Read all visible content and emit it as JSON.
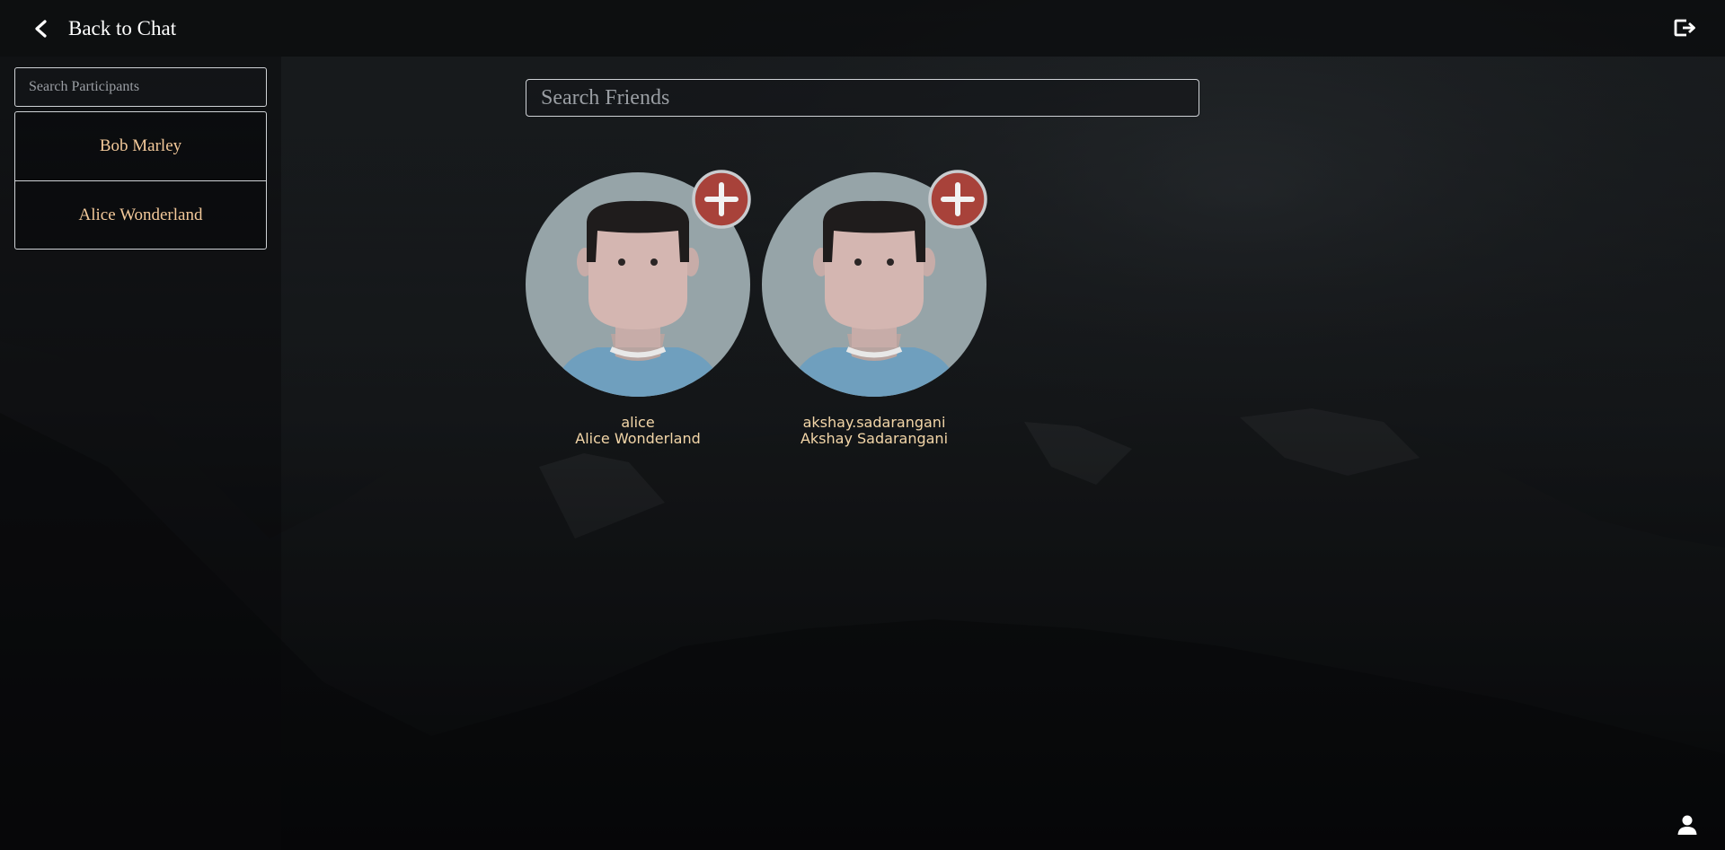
{
  "header": {
    "back_label": "Back to Chat",
    "back_icon": "chevron-left-icon",
    "logout_icon": "logout-icon"
  },
  "sidebar": {
    "search_placeholder": "Search Participants",
    "participants": [
      {
        "name": "Bob Marley"
      },
      {
        "name": "Alice Wonderland"
      }
    ]
  },
  "main": {
    "search_placeholder": "Search Friends",
    "friends": [
      {
        "username": "alice",
        "display_name": "Alice Wonderland",
        "action_icon": "plus-icon"
      },
      {
        "username": "akshay.sadarangani",
        "display_name": "Akshay Sadarangani",
        "action_icon": "plus-icon"
      }
    ]
  },
  "footer": {
    "profile_icon": "user-icon"
  },
  "colors": {
    "accent_text": "#f3c99a",
    "add_button": "#a8423a",
    "avatar_bg": "#96a4a8"
  }
}
